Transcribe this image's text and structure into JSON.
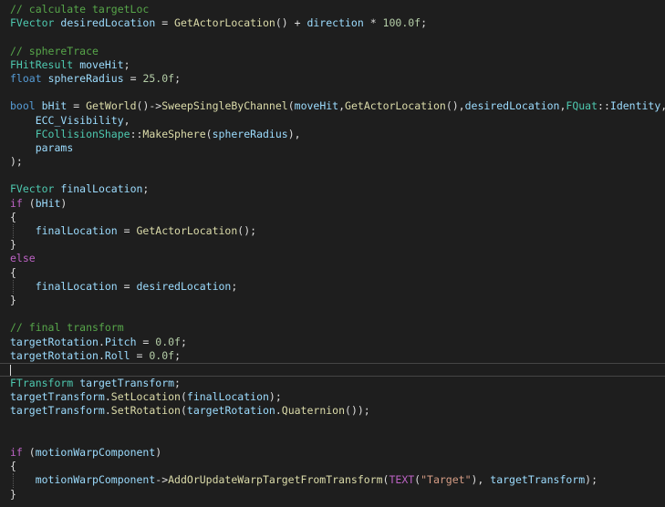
{
  "editor": {
    "colors": {
      "background": "#1e1e1e",
      "comment": "#57a64a",
      "keyword": "#569cd6",
      "type": "#4ec9b0",
      "function": "#dcdcaa",
      "variable": "#9cdcfe",
      "macro": "#bd63c5",
      "number": "#b5cea8",
      "string": "#d69d85",
      "plain": "#dcdcdc"
    },
    "lines": [
      {
        "tokens": [
          {
            "t": "// calculate targetLoc",
            "c": "comment"
          }
        ]
      },
      {
        "tokens": [
          {
            "t": "FVector",
            "c": "type"
          },
          {
            "t": " "
          },
          {
            "t": "desiredLocation",
            "c": "var"
          },
          {
            "t": " = "
          },
          {
            "t": "GetActorLocation",
            "c": "func"
          },
          {
            "t": "() + "
          },
          {
            "t": "direction",
            "c": "var"
          },
          {
            "t": " * "
          },
          {
            "t": "100.0f",
            "c": "number"
          },
          {
            "t": ";"
          }
        ]
      },
      {
        "tokens": []
      },
      {
        "tokens": [
          {
            "t": "// sphereTrace",
            "c": "comment"
          }
        ]
      },
      {
        "tokens": [
          {
            "t": "FHitResult",
            "c": "type"
          },
          {
            "t": " "
          },
          {
            "t": "moveHit",
            "c": "var"
          },
          {
            "t": ";"
          }
        ]
      },
      {
        "tokens": [
          {
            "t": "float",
            "c": "keyword"
          },
          {
            "t": " "
          },
          {
            "t": "sphereRadius",
            "c": "var"
          },
          {
            "t": " = "
          },
          {
            "t": "25.0f",
            "c": "number"
          },
          {
            "t": ";"
          }
        ]
      },
      {
        "tokens": []
      },
      {
        "tokens": [
          {
            "t": "bool",
            "c": "keyword"
          },
          {
            "t": " "
          },
          {
            "t": "bHit",
            "c": "var"
          },
          {
            "t": " = "
          },
          {
            "t": "GetWorld",
            "c": "func"
          },
          {
            "t": "()->"
          },
          {
            "t": "SweepSingleByChannel",
            "c": "func"
          },
          {
            "t": "("
          },
          {
            "t": "moveHit",
            "c": "var"
          },
          {
            "t": ","
          },
          {
            "t": "GetActorLocation",
            "c": "func"
          },
          {
            "t": "(),"
          },
          {
            "t": "desiredLocation",
            "c": "var"
          },
          {
            "t": ","
          },
          {
            "t": "FQuat",
            "c": "type"
          },
          {
            "t": "::"
          },
          {
            "t": "Identity",
            "c": "var"
          },
          {
            "t": ","
          }
        ]
      },
      {
        "tokens": [
          {
            "t": "    "
          },
          {
            "t": "ECC_Visibility",
            "c": "var"
          },
          {
            "t": ","
          }
        ]
      },
      {
        "tokens": [
          {
            "t": "    "
          },
          {
            "t": "FCollisionShape",
            "c": "type"
          },
          {
            "t": "::"
          },
          {
            "t": "MakeSphere",
            "c": "func"
          },
          {
            "t": "("
          },
          {
            "t": "sphereRadius",
            "c": "var"
          },
          {
            "t": "),"
          }
        ]
      },
      {
        "tokens": [
          {
            "t": "    "
          },
          {
            "t": "params",
            "c": "var"
          }
        ]
      },
      {
        "tokens": [
          {
            "t": ");"
          }
        ]
      },
      {
        "tokens": []
      },
      {
        "tokens": [
          {
            "t": "FVector",
            "c": "type"
          },
          {
            "t": " "
          },
          {
            "t": "finalLocation",
            "c": "var"
          },
          {
            "t": ";"
          }
        ]
      },
      {
        "tokens": [
          {
            "t": "if",
            "c": "macro"
          },
          {
            "t": " ("
          },
          {
            "t": "bHit",
            "c": "var"
          },
          {
            "t": ")"
          }
        ]
      },
      {
        "tokens": [
          {
            "t": "{"
          }
        ]
      },
      {
        "guide": true,
        "tokens": [
          {
            "t": "    "
          },
          {
            "t": "finalLocation",
            "c": "var"
          },
          {
            "t": " = "
          },
          {
            "t": "GetActorLocation",
            "c": "func"
          },
          {
            "t": "();"
          }
        ]
      },
      {
        "tokens": [
          {
            "t": "}"
          }
        ]
      },
      {
        "tokens": [
          {
            "t": "else",
            "c": "macro"
          }
        ]
      },
      {
        "tokens": [
          {
            "t": "{"
          }
        ]
      },
      {
        "guide": true,
        "tokens": [
          {
            "t": "    "
          },
          {
            "t": "finalLocation",
            "c": "var"
          },
          {
            "t": " = "
          },
          {
            "t": "desiredLocation",
            "c": "var"
          },
          {
            "t": ";"
          }
        ]
      },
      {
        "tokens": [
          {
            "t": "}"
          }
        ]
      },
      {
        "tokens": []
      },
      {
        "tokens": [
          {
            "t": "// final transform",
            "c": "comment"
          }
        ]
      },
      {
        "tokens": [
          {
            "t": "targetRotation",
            "c": "var"
          },
          {
            "t": "."
          },
          {
            "t": "Pitch",
            "c": "var"
          },
          {
            "t": " = "
          },
          {
            "t": "0.0f",
            "c": "number"
          },
          {
            "t": ";"
          }
        ]
      },
      {
        "tokens": [
          {
            "t": "targetRotation",
            "c": "var"
          },
          {
            "t": "."
          },
          {
            "t": "Roll",
            "c": "var"
          },
          {
            "t": " = "
          },
          {
            "t": "0.0f",
            "c": "number"
          },
          {
            "t": ";"
          }
        ]
      },
      {
        "current": true,
        "tokens": []
      },
      {
        "tokens": [
          {
            "t": "FTransform",
            "c": "type"
          },
          {
            "t": " "
          },
          {
            "t": "targetTransform",
            "c": "var"
          },
          {
            "t": ";"
          }
        ]
      },
      {
        "tokens": [
          {
            "t": "targetTransform",
            "c": "var"
          },
          {
            "t": "."
          },
          {
            "t": "SetLocation",
            "c": "func"
          },
          {
            "t": "("
          },
          {
            "t": "finalLocation",
            "c": "var"
          },
          {
            "t": ");"
          }
        ]
      },
      {
        "tokens": [
          {
            "t": "targetTransform",
            "c": "var"
          },
          {
            "t": "."
          },
          {
            "t": "SetRotation",
            "c": "func"
          },
          {
            "t": "("
          },
          {
            "t": "targetRotation",
            "c": "var"
          },
          {
            "t": "."
          },
          {
            "t": "Quaternion",
            "c": "func"
          },
          {
            "t": "());"
          }
        ]
      },
      {
        "tokens": []
      },
      {
        "tokens": []
      },
      {
        "tokens": [
          {
            "t": "if",
            "c": "macro"
          },
          {
            "t": " ("
          },
          {
            "t": "motionWarpComponent",
            "c": "var"
          },
          {
            "t": ")"
          }
        ]
      },
      {
        "tokens": [
          {
            "t": "{"
          }
        ]
      },
      {
        "guide": true,
        "tokens": [
          {
            "t": "    "
          },
          {
            "t": "motionWarpComponent",
            "c": "var"
          },
          {
            "t": "->"
          },
          {
            "t": "AddOrUpdateWarpTargetFromTransform",
            "c": "func"
          },
          {
            "t": "("
          },
          {
            "t": "TEXT",
            "c": "macro"
          },
          {
            "t": "("
          },
          {
            "t": "\"Target\"",
            "c": "string"
          },
          {
            "t": "), "
          },
          {
            "t": "targetTransform",
            "c": "var"
          },
          {
            "t": ");"
          }
        ]
      },
      {
        "tokens": [
          {
            "t": "}"
          }
        ]
      }
    ]
  }
}
